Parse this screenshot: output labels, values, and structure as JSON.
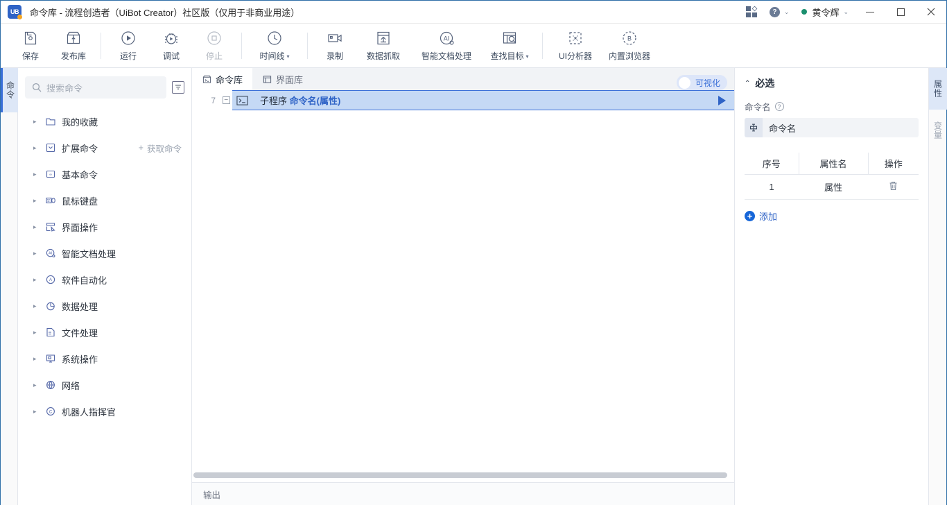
{
  "window": {
    "logo_text": "UB",
    "title": "命令库 - 流程创造者（UiBot Creator）社区版（仅用于非商业用途）",
    "minimize_label": "—",
    "maximize_label": "□",
    "close_label": "✕",
    "grid_icon": "apps-grid-icon",
    "help_icon": "help-icon",
    "help_caret": "⌄",
    "user_name": "黄令辉",
    "user_caret": "⌄",
    "status_color": "#1a8f6e"
  },
  "toolbar": {
    "items": [
      {
        "label": "保存",
        "icon": "save-icon",
        "disabled": false
      },
      {
        "label": "发布库",
        "icon": "publish-icon",
        "disabled": false
      },
      {
        "label": "运行",
        "icon": "run-icon",
        "disabled": false
      },
      {
        "label": "调试",
        "icon": "debug-icon",
        "disabled": false
      },
      {
        "label": "停止",
        "icon": "stop-icon",
        "disabled": true
      },
      {
        "label": "时间线",
        "icon": "timeline-icon",
        "disabled": false,
        "dropdown": "▾"
      },
      {
        "label": "录制",
        "icon": "record-icon",
        "disabled": false
      },
      {
        "label": "数据抓取",
        "icon": "data-scrape-icon",
        "disabled": false
      },
      {
        "label": "智能文档处理",
        "icon": "ai-doc-icon",
        "disabled": false
      },
      {
        "label": "查找目标",
        "icon": "find-target-icon",
        "disabled": false,
        "dropdown": "▾"
      },
      {
        "label": "UI分析器",
        "icon": "ui-analyzer-icon",
        "disabled": false
      },
      {
        "label": "内置浏览器",
        "icon": "browser-icon",
        "disabled": false
      }
    ]
  },
  "left_strip": {
    "tabs": [
      {
        "label": "命令",
        "active": true
      }
    ]
  },
  "sidebar": {
    "search": {
      "placeholder": "搜索命令",
      "value": "",
      "icon": "search-icon"
    },
    "filter_icon": "filter-icon",
    "get_command": {
      "label": "获取命令",
      "plus": "+"
    },
    "items": [
      {
        "label": "我的收藏",
        "icon": "folder-icon",
        "arrow": "▸"
      },
      {
        "label": "扩展命令",
        "icon": "extension-icon",
        "arrow": "▸"
      },
      {
        "label": "基本命令",
        "icon": "basic-icon",
        "arrow": "▸"
      },
      {
        "label": "鼠标键盘",
        "icon": "mouse-keyboard-icon",
        "arrow": "▸"
      },
      {
        "label": "界面操作",
        "icon": "ui-operation-icon",
        "arrow": "▸"
      },
      {
        "label": "智能文档处理",
        "icon": "ai-doc-icon",
        "arrow": "▸"
      },
      {
        "label": "软件自动化",
        "icon": "software-automation-icon",
        "arrow": "▸"
      },
      {
        "label": "数据处理",
        "icon": "data-process-icon",
        "arrow": "▸"
      },
      {
        "label": "文件处理",
        "icon": "file-process-icon",
        "arrow": "▸"
      },
      {
        "label": "系统操作",
        "icon": "system-operation-icon",
        "arrow": "▸"
      },
      {
        "label": "网络",
        "icon": "network-icon",
        "arrow": "▸"
      },
      {
        "label": "机器人指挥官",
        "icon": "commander-icon",
        "arrow": "▸"
      }
    ]
  },
  "editor": {
    "tabs": [
      {
        "label": "命令库",
        "icon": "command-library-icon",
        "active": true
      },
      {
        "label": "界面库",
        "icon": "ui-library-icon",
        "active": false
      }
    ],
    "visual_toggle": {
      "label": "可视化",
      "on": false
    },
    "lines": [
      {
        "number": "7",
        "fold": "−",
        "icon": "subroutine-icon",
        "keyword": "子程序",
        "argument": "命令名(属性)",
        "run_icon": "run-triangle-icon",
        "selected": true
      }
    ],
    "output": {
      "label": "输出"
    }
  },
  "properties": {
    "section_title": "必选",
    "section_chevron": "⌃",
    "field": {
      "label": "命令名",
      "help_icon": "help-icon",
      "type_icon": "text-input-icon",
      "value": "命令名"
    },
    "table": {
      "headers": [
        "序号",
        "属性名",
        "操作"
      ],
      "rows": [
        {
          "index": "1",
          "name": "属性",
          "action_icon": "trash-icon"
        }
      ]
    },
    "add_button": {
      "label": "添加",
      "plus": "+"
    }
  },
  "right_strip": {
    "tabs": [
      {
        "label": "属性",
        "active": true
      },
      {
        "label": "变量",
        "active": false
      }
    ]
  }
}
